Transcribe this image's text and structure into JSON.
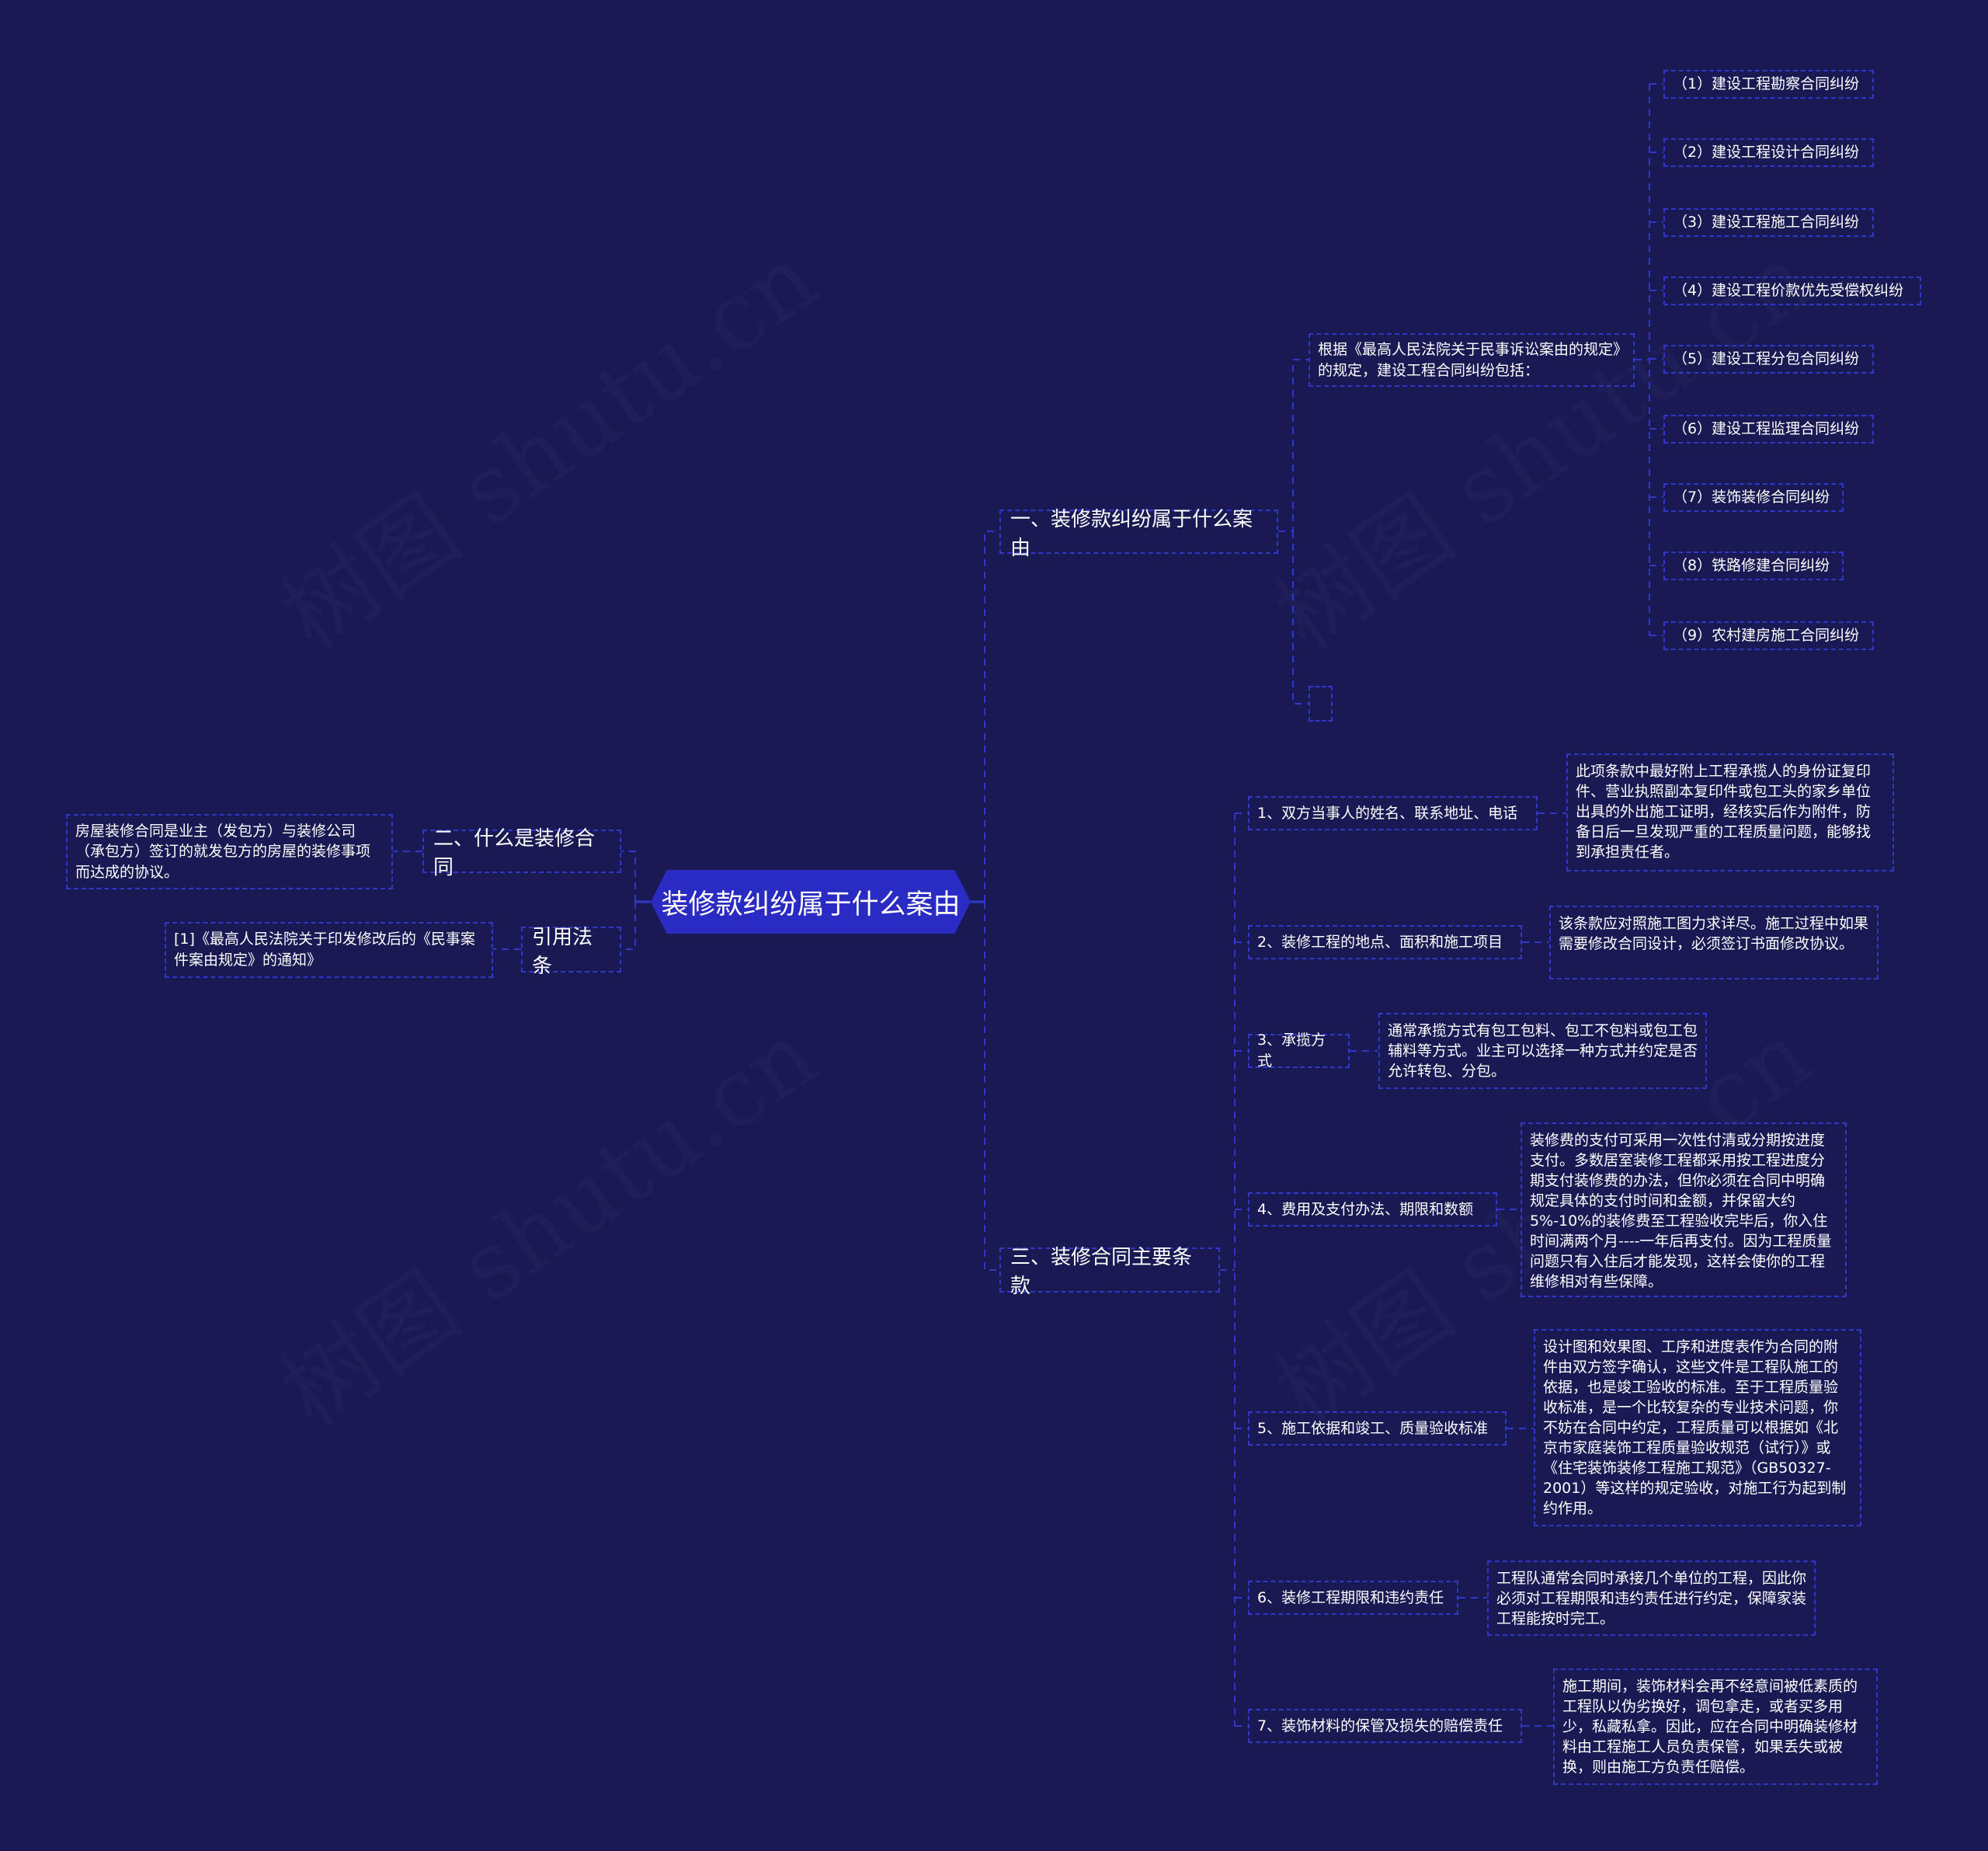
{
  "watermark": "树图 shutu.cn",
  "root": {
    "title": "装修款纠纷属于什么案由"
  },
  "branch1": {
    "title": "一、装修款纠纷属于什么案由",
    "intro": "根据《最高人民法院关于民事诉讼案由的规定》的规定，建设工程合同纠纷包括：",
    "items": [
      "（1）建设工程勘察合同纠纷",
      "（2）建设工程设计合同纠纷",
      "（3）建设工程施工合同纠纷",
      "（4）建设工程价款优先受偿权纠纷",
      "（5）建设工程分包合同纠纷",
      "（6）建设工程监理合同纠纷",
      "（7）装饰装修合同纠纷",
      "（8）铁路修建合同纠纷",
      "（9）农村建房施工合同纠纷"
    ],
    "empty_node": ""
  },
  "branch2": {
    "title": "二、什么是装修合同",
    "detail": "房屋装修合同是业主（发包方）与装修公司（承包方）签订的就发包方的房屋的装修事项而达成的协议。"
  },
  "branch_ref": {
    "title": "引用法条",
    "detail": "[1]《最高人民法院关于印发修改后的《民事案件案由规定》的通知》"
  },
  "branch3": {
    "title": "三、装修合同主要条款",
    "clauses": [
      {
        "label": "1、双方当事人的姓名、联系地址、电话",
        "detail": "此项条款中最好附上工程承揽人的身份证复印件、营业执照副本复印件或包工头的家乡单位出具的外出施工证明，经核实后作为附件，防备日后一旦发现严重的工程质量问题，能够找到承担责任者。"
      },
      {
        "label": "2、装修工程的地点、面积和施工项目",
        "detail": "该条款应对照施工图力求详尽。施工过程中如果需要修改合同设计，必须签订书面修改协议。"
      },
      {
        "label": "3、承揽方式",
        "detail": "通常承揽方式有包工包料、包工不包料或包工包辅料等方式。业主可以选择一种方式并约定是否允许转包、分包。"
      },
      {
        "label": "4、费用及支付办法、期限和数额",
        "detail": "装修费的支付可采用一次性付清或分期按进度支付。多数居室装修工程都采用按工程进度分期支付装修费的办法，但你必须在合同中明确规定具体的支付时间和金额，并保留大约5%-10%的装修费至工程验收完毕后，你入住时间满两个月----一年后再支付。因为工程质量问题只有入住后才能发现，这样会使你的工程维修相对有些保障。"
      },
      {
        "label": "5、施工依据和竣工、质量验收标准",
        "detail": "设计图和效果图、工序和进度表作为合同的附件由双方签字确认，这些文件是工程队施工的依据，也是竣工验收的标准。至于工程质量验收标准，是一个比较复杂的专业技术问题，你不妨在合同中约定，工程质量可以根据如《北京市家庭装饰工程质量验收规范（试行）》或《住宅装饰装修工程施工规范》（GB50327-2001）等这样的规定验收，对施工行为起到制约作用。"
      },
      {
        "label": "6、装修工程期限和违约责任",
        "detail": "工程队通常会同时承接几个单位的工程，因此你必须对工程期限和违约责任进行约定，保障家装工程能按时完工。"
      },
      {
        "label": "7、装饰材料的保管及损失的赔偿责任",
        "detail": "施工期间，装饰材料会再不经意间被低素质的工程队以伪劣换好，调包拿走，或者买多用少，私藏私拿。因此，应在合同中明确装修材料由工程施工人员负责保管，如果丢失或被换，则由施工方负责任赔偿。"
      }
    ]
  },
  "colors": {
    "background": "#191954",
    "root_fill": "#2a2bc2",
    "line": "#3337c9",
    "text": "#ffffff"
  }
}
